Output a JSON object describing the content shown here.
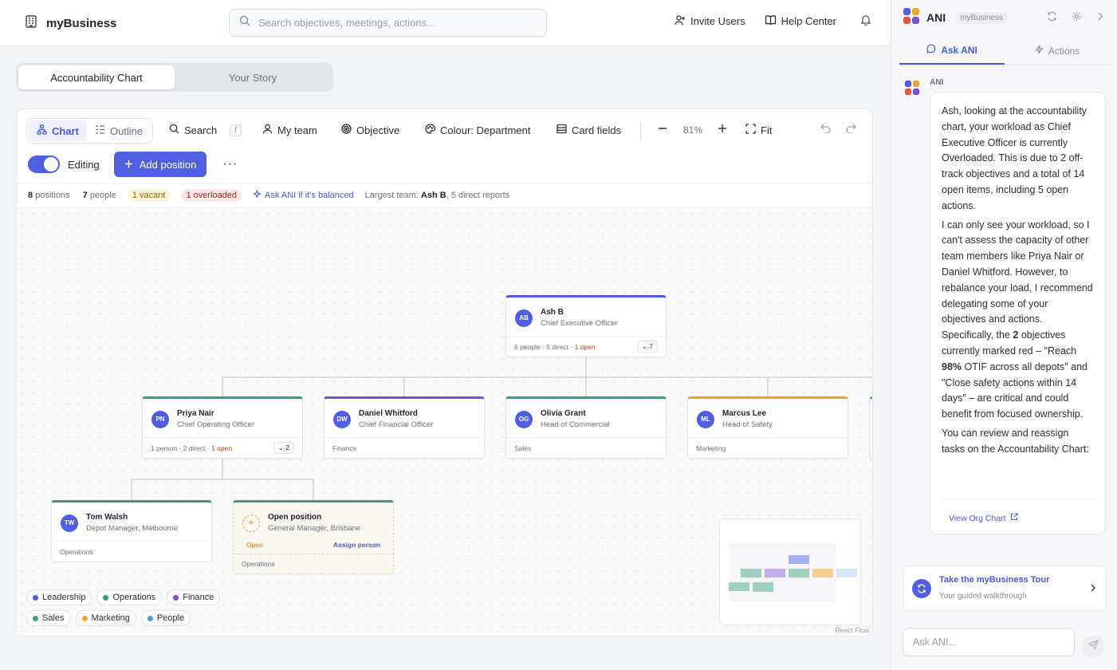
{
  "header": {
    "brand": "myBusiness",
    "search_placeholder": "Search objectives, meetings, actions...",
    "invite_label": "Invite Users",
    "help_label": "Help Center"
  },
  "tabs": [
    {
      "label": "Accountability Chart",
      "active": true
    },
    {
      "label": "Your Story",
      "active": false
    }
  ],
  "toolbar": {
    "chart_label": "Chart",
    "outline_label": "Outline",
    "search_label": "Search",
    "search_key": "/",
    "myteam_label": "My team",
    "objective_label": "Objective",
    "colour_label": "Colour: Department",
    "cardfields_label": "Card fields",
    "zoom": "81%",
    "fit_label": "Fit",
    "editing_label": "Editing",
    "editing_on": true,
    "add_label": "Add position"
  },
  "stats": {
    "positions_num": "8",
    "positions_label": "positions",
    "people_num": "7",
    "people_label": "people",
    "vacant": "1 vacant",
    "overloaded": "1 overloaded",
    "ask_link": "Ask ANI if it's balanced",
    "largest_prefix": "Largest team:",
    "largest_name": "Ash B",
    "largest_suffix": ", 5 direct reports"
  },
  "nodes": {
    "ash": {
      "initials": "AB",
      "name": "Ash B",
      "role": "Chief Executive Officer",
      "meta": "6 people · 5 direct · ",
      "open": "1 open",
      "count": "7",
      "color": "#4f5fe0"
    },
    "priya": {
      "initials": "PN",
      "name": "Priya Nair",
      "role": "Chief Operating Officer",
      "meta": "1 person · 2 direct · ",
      "open": "1 open",
      "count": "2",
      "color": "#3d9a7a"
    },
    "daniel": {
      "initials": "DW",
      "name": "Daniel Whitford",
      "role": "Chief Financial Officer",
      "dept": "Finance",
      "color": "#7b4fd6"
    },
    "olivia": {
      "initials": "OG",
      "name": "Olivia Grant",
      "role": "Head of Commercial",
      "dept": "Sales",
      "color": "#3d9a7a"
    },
    "marcus": {
      "initials": "ML",
      "name": "Marcus Lee",
      "role": "Head of Safety",
      "dept": "Marketing",
      "color": "#e8a23a"
    },
    "tom": {
      "initials": "TW",
      "name": "Tom Walsh",
      "role": "Depot Manager, Melbourne",
      "dept": "Operations",
      "color": "#3d9a7a"
    },
    "open": {
      "name": "Open position",
      "role": "General Manager, Brisbane",
      "status": "Open",
      "assign": "Assign person",
      "dept": "Operations",
      "color": "#3d9a7a"
    }
  },
  "legend": [
    {
      "label": "Leadership",
      "color": "#4f5fe0"
    },
    {
      "label": "Operations",
      "color": "#3d9a7a"
    },
    {
      "label": "Finance",
      "color": "#7b4fd6"
    },
    {
      "label": "Sales",
      "color": "#3d9a7a"
    },
    {
      "label": "Marketing",
      "color": "#e8a23a"
    },
    {
      "label": "People",
      "color": "#4b9fd1"
    }
  ],
  "react_flow": "React Flow",
  "sidebar": {
    "title": "ANI",
    "workspace": "myBusiness",
    "tab_ask": "Ask ANI",
    "tab_actions": "Actions",
    "author": "ANI",
    "p1": "Ash, looking at the accountability chart, your workload as Chief Executive Officer is currently Overloaded. This is due to 2 off-track objectives and a total of 14 open items, including 5 open actions.",
    "p2_a": "I can only see your workload, so I can't assess the capacity of other team members like Priya Nair or Daniel Whitford. However, to rebalance your load, I recommend delegating some of your objectives and actions. Specifically, the ",
    "p2_b": "2",
    "p2_c": " objectives currently marked red – \"Reach ",
    "p2_d": "98%",
    "p2_e": " OTIF across all depots\" and \"Close safety actions within 14 days\" – are critical and could benefit from focused ownership.",
    "p3": "You can review and reassign tasks on the Accountability Chart:",
    "link": "View Org Chart",
    "tour_title": "Take the myBusiness Tour",
    "tour_sub": "Your guided walkthrough",
    "input_placeholder": "Ask ANI..."
  }
}
